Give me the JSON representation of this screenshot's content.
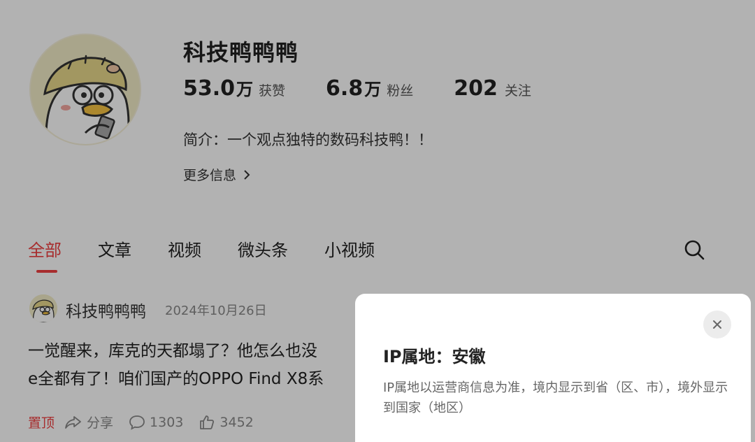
{
  "profile": {
    "name": "科技鸭鸭鸭",
    "stats": [
      {
        "value": "53.0",
        "unit": "万",
        "label": "获赞"
      },
      {
        "value": "6.8",
        "unit": "万",
        "label": "粉丝"
      },
      {
        "value": "202",
        "unit": "",
        "label": "关注"
      }
    ],
    "bio": "简介：一个观点独特的数码科技鸭！！",
    "more_info": "更多信息"
  },
  "tabs": [
    {
      "label": "全部",
      "active": true
    },
    {
      "label": "文章",
      "active": false
    },
    {
      "label": "视频",
      "active": false
    },
    {
      "label": "微头条",
      "active": false
    },
    {
      "label": "小视频",
      "active": false
    }
  ],
  "post": {
    "author": "科技鸭鸭鸭",
    "date": "2024年10月26日",
    "text_line1": "一觉醒来，库克的天都塌了？他怎么也没",
    "text_line2": "e全都有了！咱们国产的OPPO Find X8系",
    "pinned": "置顶",
    "share": "分享",
    "comments": "1303",
    "likes": "3452"
  },
  "popup": {
    "title": "IP属地：安徽",
    "description": "IP属地以运营商信息为准，境内显示到省（区、市），境外显示到国家（地区）"
  },
  "colors": {
    "accent": "#f04142",
    "overlay": "rgba(0,0,0,0.30)",
    "avatar_bg": "#f2ecc8"
  },
  "icons": [
    "duck-avatar-icon",
    "chevron-right-icon",
    "search-icon",
    "share-icon",
    "comment-icon",
    "like-icon",
    "close-icon"
  ]
}
